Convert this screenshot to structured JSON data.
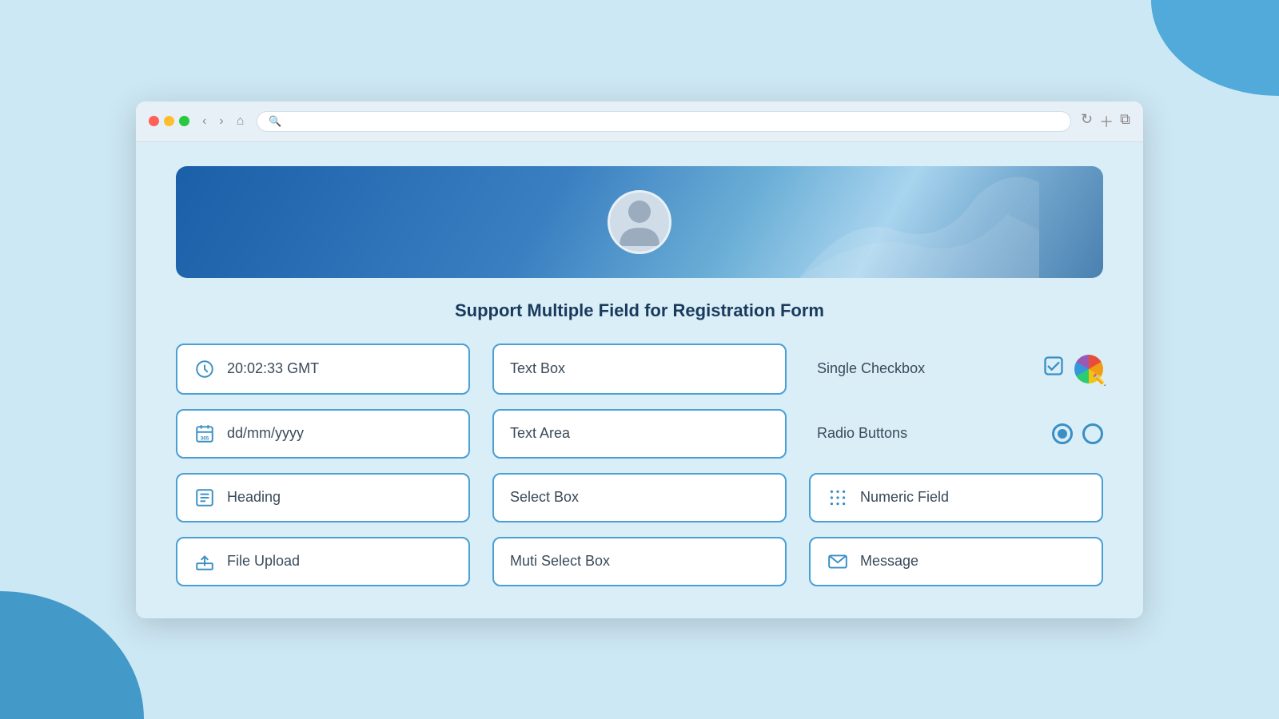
{
  "browser": {
    "dots": [
      "red",
      "yellow",
      "green"
    ],
    "search_placeholder": "Search",
    "address": ""
  },
  "hero": {
    "avatar_alt": "User Avatar"
  },
  "page": {
    "title": "Support Multiple Field for Registration Form"
  },
  "fields": [
    {
      "id": "time",
      "icon": "clock",
      "label": "20:02:33 GMT",
      "col": 0
    },
    {
      "id": "text-box",
      "icon": "none",
      "label": "Text Box",
      "col": 1
    },
    {
      "id": "single-checkbox",
      "icon": "checkbox",
      "label": "Single Checkbox",
      "col": 2,
      "special": "checkbox"
    },
    {
      "id": "date",
      "icon": "calendar",
      "label": "dd/mm/yyyy",
      "col": 0
    },
    {
      "id": "text-area",
      "icon": "none",
      "label": "Text Area",
      "col": 1
    },
    {
      "id": "radio-buttons",
      "icon": "radio",
      "label": "Radio Buttons",
      "col": 2,
      "special": "radio"
    },
    {
      "id": "heading",
      "icon": "heading",
      "label": "Heading",
      "col": 0
    },
    {
      "id": "select-box",
      "icon": "none",
      "label": "Select Box",
      "col": 1
    },
    {
      "id": "numeric-field",
      "icon": "grid",
      "label": "Numeric Field",
      "col": 2
    },
    {
      "id": "file-upload",
      "icon": "upload",
      "label": "File Upload",
      "col": 0
    },
    {
      "id": "multi-select",
      "icon": "none",
      "label": "Muti Select Box",
      "col": 1
    },
    {
      "id": "message",
      "icon": "envelope",
      "label": "Message",
      "col": 2
    }
  ]
}
